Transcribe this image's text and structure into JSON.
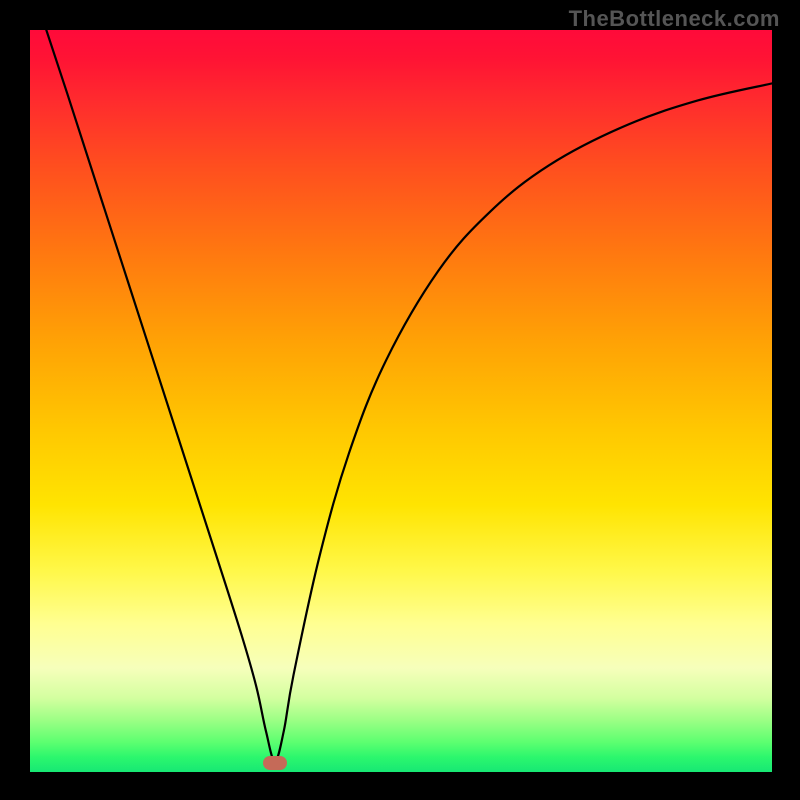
{
  "watermark": "TheBottleneck.com",
  "chart_data": {
    "type": "line",
    "title": "",
    "xlabel": "",
    "ylabel": "",
    "xlim": [
      0,
      1
    ],
    "ylim": [
      0,
      1
    ],
    "grid": false,
    "legend": false,
    "series": [
      {
        "name": "curve",
        "x": [
          0.022,
          0.05,
          0.1,
          0.15,
          0.2,
          0.25,
          0.285,
          0.305,
          0.318,
          0.33,
          0.342,
          0.355,
          0.39,
          0.43,
          0.48,
          0.55,
          0.62,
          0.7,
          0.8,
          0.9,
          1.0
        ],
        "y": [
          1.0,
          0.915,
          0.76,
          0.605,
          0.45,
          0.295,
          0.185,
          0.115,
          0.055,
          0.015,
          0.055,
          0.13,
          0.29,
          0.43,
          0.555,
          0.675,
          0.755,
          0.818,
          0.87,
          0.905,
          0.928
        ],
        "color": "#000000"
      }
    ],
    "marker": {
      "x": 0.33,
      "y": 0.012,
      "color": "#c56a58"
    },
    "gradient_stops": [
      {
        "pos": 0.0,
        "color": "#ff0a3a"
      },
      {
        "pos": 0.3,
        "color": "#ff7810"
      },
      {
        "pos": 0.64,
        "color": "#ffe401"
      },
      {
        "pos": 0.86,
        "color": "#f6ffbb"
      },
      {
        "pos": 1.0,
        "color": "#17e874"
      }
    ]
  }
}
